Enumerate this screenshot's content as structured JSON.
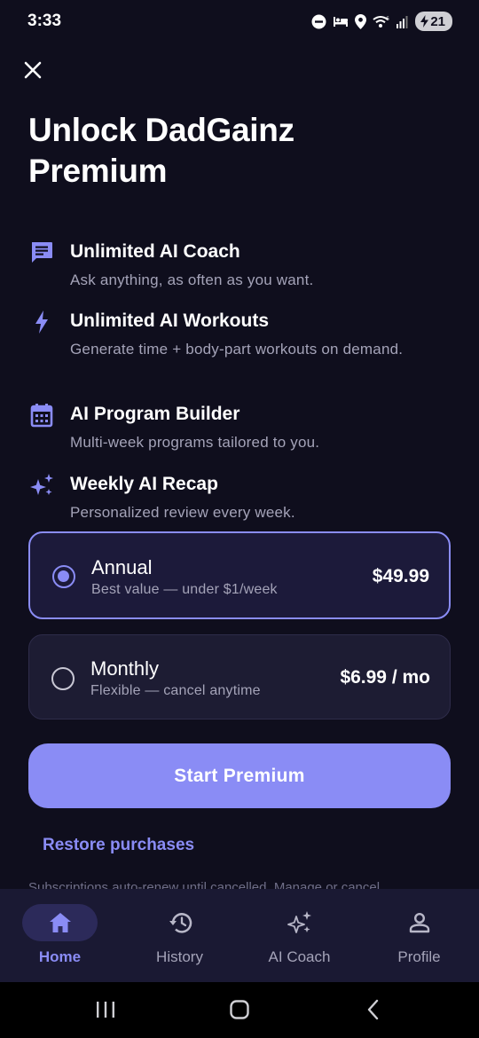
{
  "status_bar": {
    "time": "3:33",
    "battery_level": "21"
  },
  "header": {
    "close_icon": "close-icon",
    "title": "Unlock DadGainz Premium"
  },
  "features": [
    {
      "icon": "chat-icon",
      "title": "Unlimited AI Coach",
      "description": "Ask anything, as often as you want."
    },
    {
      "icon": "bolt-icon",
      "title": "Unlimited AI Workouts",
      "description": "Generate time + body-part workouts on demand."
    },
    {
      "icon": "calendar-icon",
      "title": "AI Program Builder",
      "description": "Multi-week programs tailored to you."
    },
    {
      "icon": "sparkles-icon",
      "title": "Weekly AI Recap",
      "description": "Personalized review every week."
    }
  ],
  "plans": [
    {
      "name": "Annual",
      "subtitle": "Best value — under $1/week",
      "price": "$49.99",
      "selected": true
    },
    {
      "name": "Monthly",
      "subtitle": "Flexible — cancel anytime",
      "price": "$6.99 / mo",
      "selected": false
    }
  ],
  "cta": {
    "label": "Start Premium"
  },
  "restore": {
    "label": "Restore purchases"
  },
  "fine_print": "Subscriptions auto-renew until cancelled. Manage or cancel",
  "bottom_nav": [
    {
      "label": "Home",
      "icon": "home-icon",
      "active": true
    },
    {
      "label": "History",
      "icon": "history-icon",
      "active": false
    },
    {
      "label": "AI Coach",
      "icon": "sparkles-icon",
      "active": false
    },
    {
      "label": "Profile",
      "icon": "profile-icon",
      "active": false
    }
  ],
  "colors": {
    "background": "#0f0e1d",
    "accent": "#8a8cf5",
    "card": "#1d1c33",
    "nav_background": "#1a1933",
    "secondary_text": "#a4a3b8"
  }
}
